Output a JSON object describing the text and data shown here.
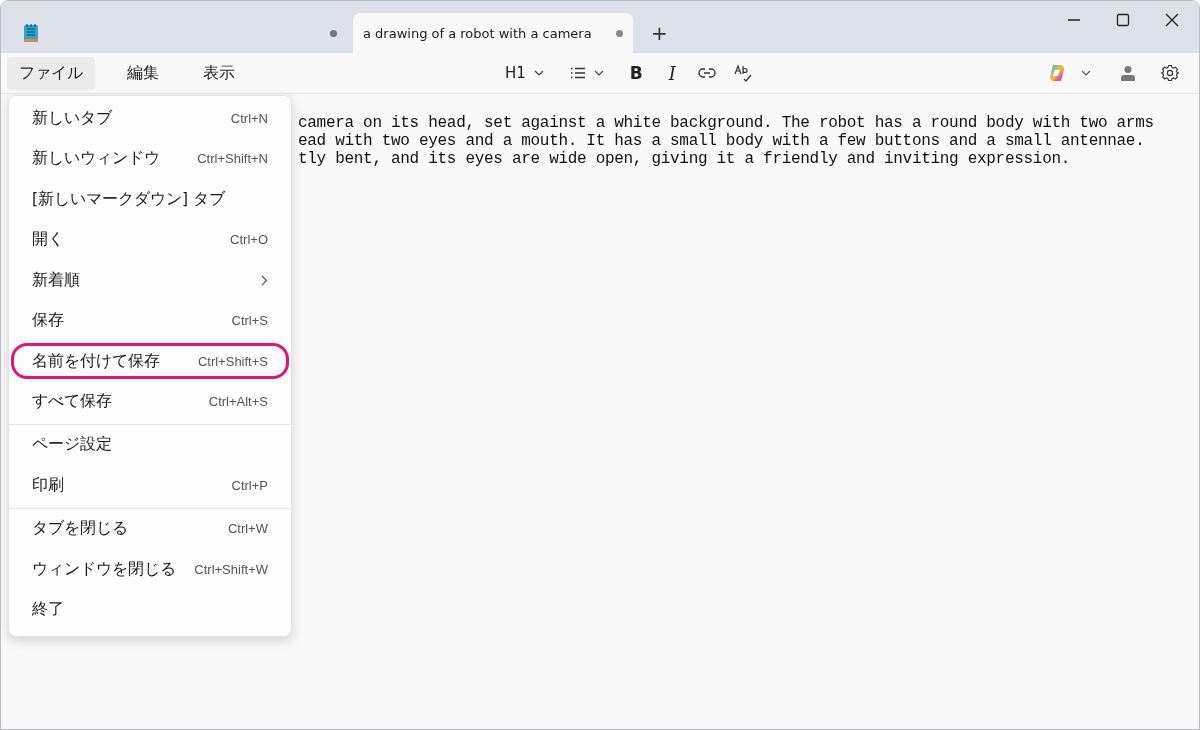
{
  "tabs": [
    {
      "unsaved": true,
      "selected": false
    },
    {
      "title": "a drawing of a robot with a camera",
      "unsaved": true,
      "selected": true
    }
  ],
  "new_tab": "+",
  "menu_bar": [
    {
      "label": "ファイル",
      "selected": true
    },
    {
      "label": "編集",
      "selected": false
    },
    {
      "label": "表示",
      "selected": false
    }
  ],
  "toolbar": [
    {
      "kind": "heading",
      "label": "H1"
    },
    {
      "kind": "list"
    },
    {
      "kind": "bold",
      "label": "B"
    },
    {
      "kind": "italic",
      "label": "I"
    },
    {
      "kind": "link"
    },
    {
      "kind": "spell"
    }
  ],
  "document": {
    "lines": [
      "camera on its head, set against a white background. The robot has a round body with two arms",
      "ead with two eyes and a mouth. It has a small body with a few buttons and a small antennae.",
      "tly bent, and its eyes are wide open, giving it a friendly and inviting expression."
    ]
  },
  "file_menu": {
    "groups": [
      [
        {
          "label": "新しいタブ",
          "shortcut": "Ctrl+N",
          "submenu": false,
          "highlighted": false
        },
        {
          "label": "新しいウィンドウ",
          "shortcut": "Ctrl+Shift+N",
          "submenu": false,
          "highlighted": false
        },
        {
          "label": "[新しいマークダウン] タブ",
          "submenu": false,
          "highlighted": false
        },
        {
          "label": "開く",
          "shortcut": "Ctrl+O",
          "submenu": false,
          "highlighted": false
        },
        {
          "label": "新着順",
          "submenu": true,
          "highlighted": false
        },
        {
          "label": "保存",
          "shortcut": "Ctrl+S",
          "submenu": false,
          "highlighted": false
        },
        {
          "label": "名前を付けて保存",
          "shortcut": "Ctrl+Shift+S",
          "submenu": false,
          "highlighted": true
        },
        {
          "label": "すべて保存",
          "shortcut": "Ctrl+Alt+S",
          "submenu": false,
          "highlighted": false
        }
      ],
      [
        {
          "label": "ページ設定",
          "submenu": false,
          "highlighted": false
        },
        {
          "label": "印刷",
          "shortcut": "Ctrl+P",
          "submenu": false,
          "highlighted": false
        }
      ],
      [
        {
          "label": "タブを閉じる",
          "shortcut": "Ctrl+W",
          "submenu": false,
          "highlighted": false
        },
        {
          "label": "ウィンドウを閉じる",
          "shortcut": "Ctrl+Shift+W",
          "submenu": false,
          "highlighted": false
        },
        {
          "label": "終了",
          "submenu": false,
          "highlighted": false
        }
      ]
    ]
  }
}
